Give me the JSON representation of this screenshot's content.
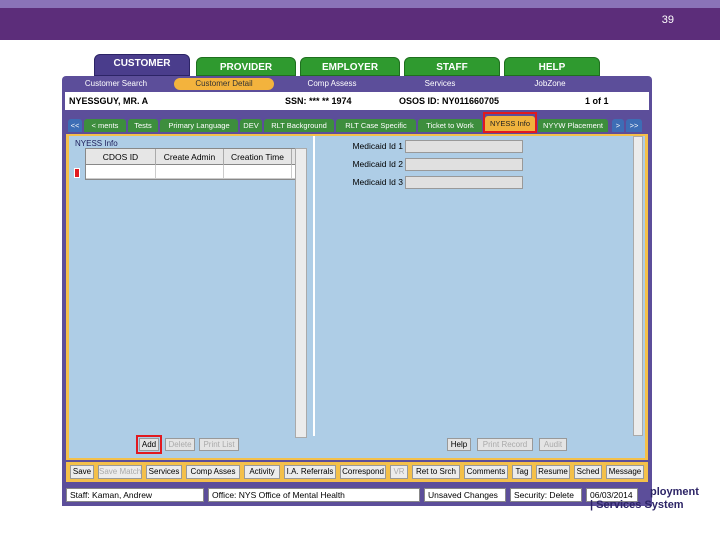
{
  "slide": {
    "number": "39"
  },
  "main_tabs": [
    "CUSTOMER",
    "PROVIDER",
    "EMPLOYER",
    "STAFF",
    "HELP"
  ],
  "menu": [
    "Customer Search",
    "Customer Detail",
    "Comp Assess",
    "Services",
    "JobZone"
  ],
  "customer": {
    "name": "NYESSGUY, MR. A",
    "ssn": "SSN: *** ** 1974",
    "osos_id": "OSOS ID: NY011660705",
    "pager": "1 of 1"
  },
  "sub_tabs": [
    "<<",
    "< ments",
    "Tests",
    "Primary Language",
    "DEV",
    "RLT Background",
    "RLT Case Specific",
    "Ticket to Work",
    "NYESS Info",
    "NYYW Placement",
    ">",
    ">>"
  ],
  "nyess_info": {
    "label": "NYESS Info",
    "columns": [
      "CDOS ID",
      "Create Admin",
      "Creation Time",
      "~"
    ],
    "medicaid_labels": [
      "Medicaid Id 1",
      "Medicaid Id 2",
      "Medicaid Id 3"
    ],
    "left_buttons": [
      "Add",
      "Delete",
      "Print List"
    ],
    "right_buttons": [
      "Help",
      "Print Record",
      "Audit"
    ]
  },
  "bottom_buttons": [
    "Save",
    "Save Match",
    "Services",
    "Comp Asses",
    "Activity",
    "I.A. Referrals",
    "Correspond",
    "VR",
    "Ret to Srch",
    "Comments",
    "Tag",
    "Resume",
    "Sched",
    "Message"
  ],
  "status": {
    "staff": "Staff: Kaman, Andrew",
    "office": "Office: NYS Office of Mental Health",
    "changes": "Unsaved Changes",
    "security": "Security: Delete",
    "date": "06/03/2014"
  },
  "logo": {
    "line1": "ployment",
    "line2": "| Services System"
  },
  "colors": {
    "header": "#5c2d7a",
    "app_frame": "#5c4e9a",
    "tab_green": "#2f9a2f",
    "accent_orange": "#f4c04a",
    "highlight": "#e1191f",
    "panel_blue": "#aecde6"
  }
}
